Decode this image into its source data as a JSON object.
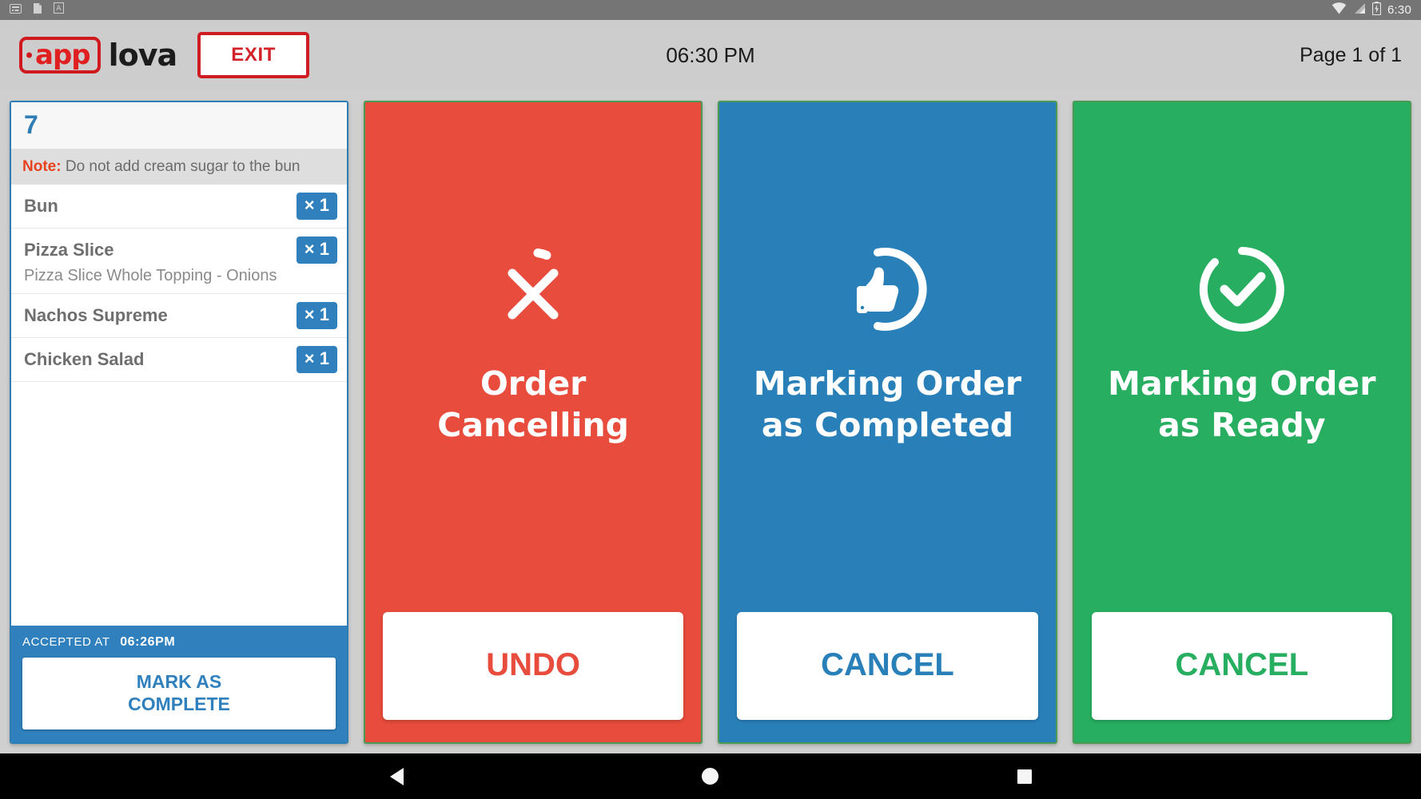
{
  "status_bar": {
    "left_icons": [
      "keyboard-icon",
      "document-icon",
      "font-icon"
    ],
    "wifi_icon": "wifi-icon",
    "signal_icon": "cellular-signal-icon",
    "battery_icon": "battery-charging-icon",
    "time": "6:30"
  },
  "header": {
    "logo_app": "app",
    "logo_lova": "lova",
    "exit_label": "EXIT",
    "clock": "06:30 PM",
    "page_indicator": "Page 1 of 1"
  },
  "order_card": {
    "order_number": "7",
    "note_label": "Note:",
    "note_text": "Do not add cream sugar to the bun",
    "items": [
      {
        "name": "Bun",
        "qty": "× 1",
        "sub": ""
      },
      {
        "name": "Pizza Slice",
        "qty": "× 1",
        "sub": "Pizza Slice Whole Topping - Onions"
      },
      {
        "name": "Nachos Supreme",
        "qty": "× 1",
        "sub": ""
      },
      {
        "name": "Chicken Salad",
        "qty": "× 1",
        "sub": ""
      }
    ],
    "accepted_label": "ACCEPTED AT",
    "accepted_time": "06:26PM",
    "action_label": "MARK AS\nCOMPLETE",
    "action_line1": "MARK AS",
    "action_line2": "COMPLETE",
    "accent_color": "#2f80bd"
  },
  "panels": [
    {
      "id": "cancelling",
      "icon": "close-x-spinner-icon",
      "title_line1": "Order Cancelling",
      "title_line2": "",
      "action_label": "UNDO",
      "bg_color": "#e74c3c",
      "action_text_color": "#e74c3c"
    },
    {
      "id": "completing",
      "icon": "thumbs-up-spinner-icon",
      "title_line1": "Marking Order",
      "title_line2": "as Completed",
      "action_label": "CANCEL",
      "bg_color": "#2980b9",
      "action_text_color": "#2980b9"
    },
    {
      "id": "ready",
      "icon": "check-circle-spinner-icon",
      "title_line1": "Marking Order",
      "title_line2": "as Ready",
      "action_label": "CANCEL",
      "bg_color": "#27ae60",
      "action_text_color": "#27ae60"
    }
  ],
  "nav_bar": {
    "back": "back-icon",
    "home": "home-icon",
    "recents": "recents-icon"
  }
}
